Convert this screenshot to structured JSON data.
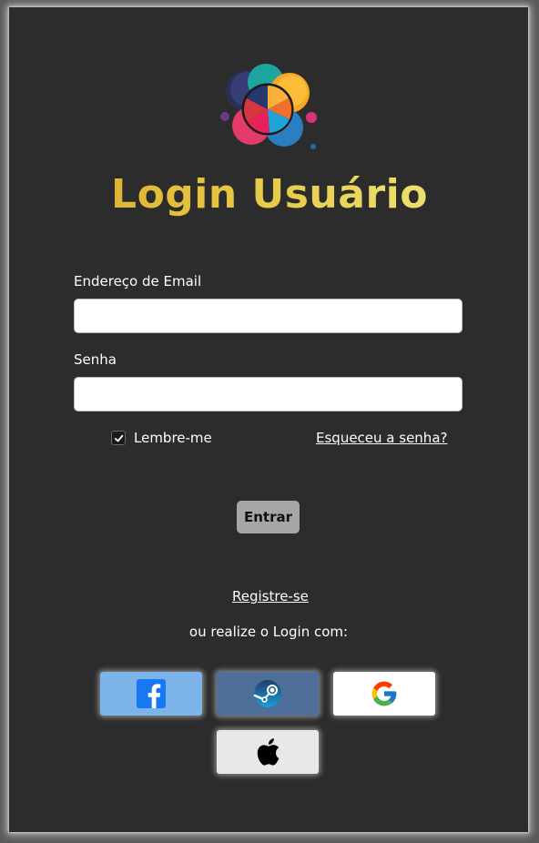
{
  "page": {
    "title": "Login Usuário"
  },
  "form": {
    "email_label": "Endereço de Email",
    "email_value": "",
    "password_label": "Senha",
    "password_value": "",
    "remember_label": "Lembre-me",
    "remember_checked": true,
    "forgot_link": "Esqueceu a senha?",
    "submit_label": "Entrar"
  },
  "footer": {
    "register_link": "Registre-se",
    "alt_login_text": "ou realize o Login com:"
  },
  "social_logins": [
    {
      "name": "facebook",
      "icon": "facebook-icon",
      "bg": "#7cb3e8"
    },
    {
      "name": "steam",
      "icon": "steam-icon",
      "bg": "#4d6f9a"
    },
    {
      "name": "google",
      "icon": "google-icon",
      "bg": "#ffffff"
    },
    {
      "name": "apple",
      "icon": "apple-icon",
      "bg": "#e8e8e8"
    }
  ],
  "colors": {
    "background": "#2c2c2c",
    "title_gradient_start": "#d9a52a",
    "title_gradient_end": "#f1ee86",
    "button": "#a6a6a6"
  }
}
